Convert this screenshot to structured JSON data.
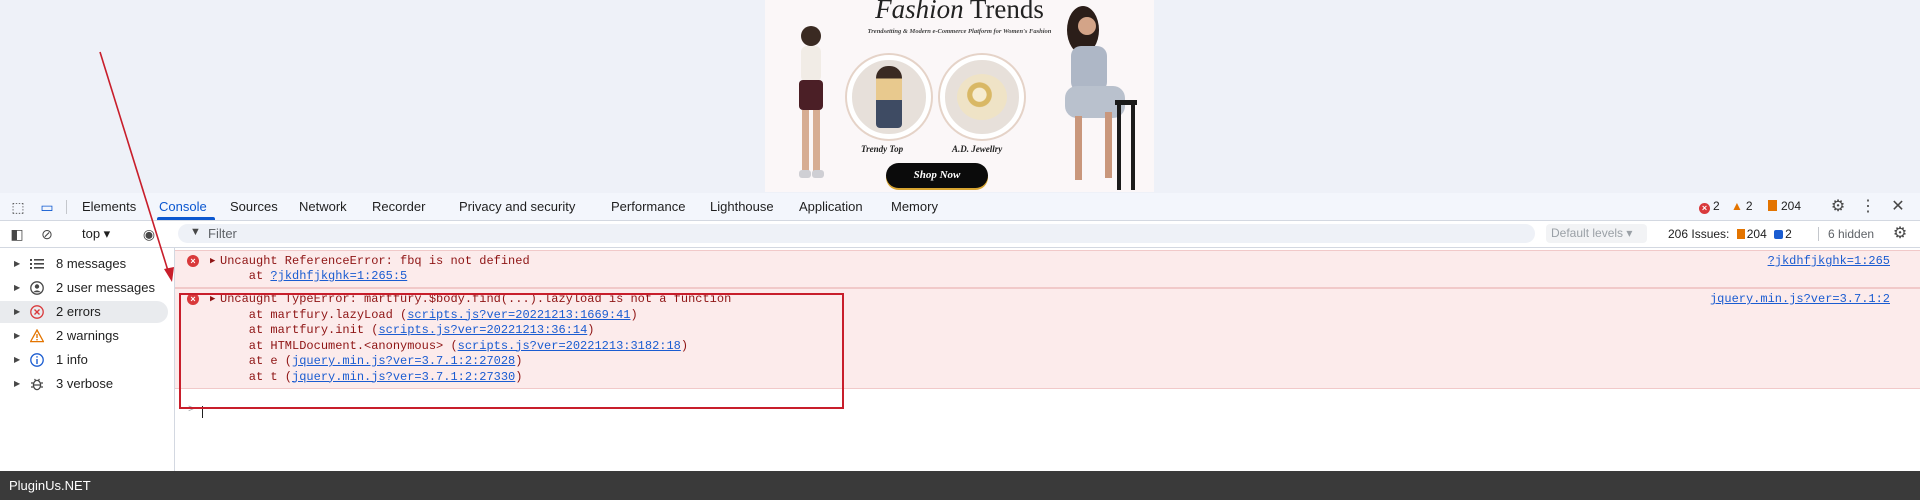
{
  "banner": {
    "title_script": "Fashion",
    "title_rest": " Trends",
    "subtitle": "Trendsetting & Modern e-Commerce Platform for Women's Fashion",
    "item1_label": "Trendy Top",
    "item2_label": "A.D. Jewellry",
    "cta": "Shop Now"
  },
  "devtools": {
    "tabs": [
      {
        "label": "Elements"
      },
      {
        "label": "Console"
      },
      {
        "label": "Sources"
      },
      {
        "label": "Network"
      },
      {
        "label": "Recorder"
      },
      {
        "label": "Privacy and security"
      },
      {
        "label": "Performance"
      },
      {
        "label": "Lighthouse"
      },
      {
        "label": "Application"
      },
      {
        "label": "Memory"
      }
    ],
    "active_tab": "Console",
    "counts": {
      "errors": "2",
      "warnings": "2",
      "issues": "204"
    },
    "toolbar": {
      "context": "top ▾",
      "filter_placeholder": "Filter",
      "levels": "Default levels ▾",
      "issues_label": "206 Issues:",
      "issues_warn": "204",
      "issues_info": "2",
      "hidden": "6 hidden"
    },
    "sidebar": [
      {
        "label": "8 messages",
        "icon": "list-icon"
      },
      {
        "label": "2 user messages",
        "icon": "user-icon"
      },
      {
        "label": "2 errors",
        "icon": "error-icon"
      },
      {
        "label": "2 warnings",
        "icon": "warning-icon"
      },
      {
        "label": "1 info",
        "icon": "info-icon"
      },
      {
        "label": "3 verbose",
        "icon": "bug-icon"
      }
    ],
    "messages": [
      {
        "text": "Uncaught ReferenceError: fbq is not defined",
        "at_prefix": "    at ",
        "at_link": "?jkdhfjkghk=1:265:5",
        "source": "?jkdhfjkghk=1:265"
      },
      {
        "text": "Uncaught TypeError: martfury.$body.find(...).lazyload is not a function",
        "source": "jquery.min.js?ver=3.7.1:2",
        "stack": [
          {
            "prefix": "    at martfury.lazyLoad (",
            "link": "scripts.js?ver=20221213:1669:41",
            "suffix": ")"
          },
          {
            "prefix": "    at martfury.init (",
            "link": "scripts.js?ver=20221213:36:14",
            "suffix": ")"
          },
          {
            "prefix": "    at HTMLDocument.<anonymous> (",
            "link": "scripts.js?ver=20221213:3182:18",
            "suffix": ")"
          },
          {
            "prefix": "    at e (",
            "link": "jquery.min.js?ver=3.7.1:2:27028",
            "suffix": ")"
          },
          {
            "prefix": "    at t (",
            "link": "jquery.min.js?ver=3.7.1:2:27330",
            "suffix": ")"
          }
        ]
      }
    ],
    "prompt": ">"
  },
  "footer": {
    "text": "PluginUs.NET"
  },
  "colors": {
    "accent": "#0b57d0",
    "error": "#d9393b",
    "warning": "#e37400",
    "annotation": "#c81e2b"
  }
}
